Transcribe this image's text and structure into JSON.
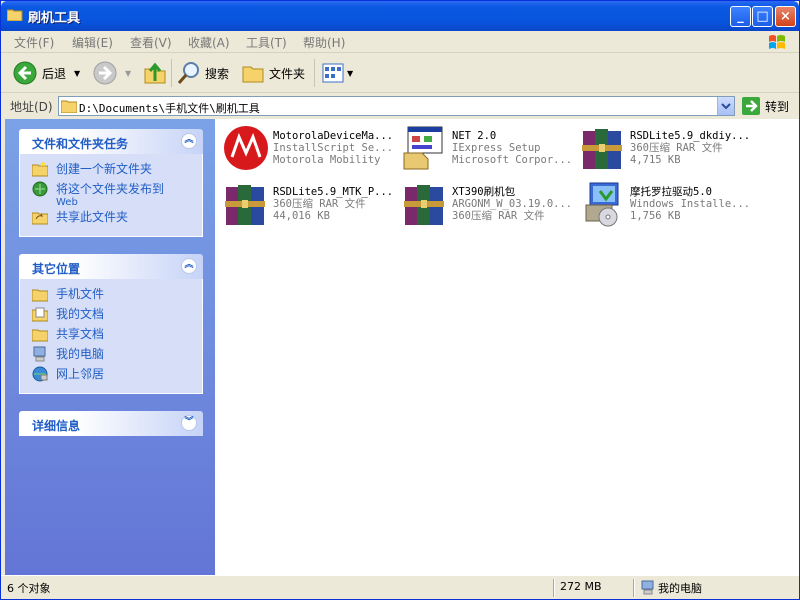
{
  "window": {
    "title": "刷机工具",
    "minimize": "_",
    "maximize": "□",
    "close": "×"
  },
  "menu": [
    "文件(F)",
    "编辑(E)",
    "查看(V)",
    "收藏(A)",
    "工具(T)",
    "帮助(H)"
  ],
  "toolbar": {
    "back": "后退",
    "search": "搜索",
    "folders": "文件夹"
  },
  "address": {
    "label": "地址(D)",
    "path": "D:\\Documents\\手机文件\\刷机工具",
    "go": "转到"
  },
  "tasks_panel": {
    "title": "文件和文件夹任务",
    "items": [
      {
        "label": "创建一个新文件夹",
        "icon": "new-folder-icon"
      },
      {
        "label": "将这个文件夹发布到",
        "sub": "Web",
        "icon": "publish-web-icon"
      },
      {
        "label": "共享此文件夹",
        "icon": "share-folder-icon"
      }
    ]
  },
  "places_panel": {
    "title": "其它位置",
    "items": [
      {
        "label": "手机文件",
        "icon": "folder-icon"
      },
      {
        "label": "我的文档",
        "icon": "my-documents-icon"
      },
      {
        "label": "共享文档",
        "icon": "shared-docs-icon"
      },
      {
        "label": "我的电脑",
        "icon": "computer-icon"
      },
      {
        "label": "网上邻居",
        "icon": "network-icon"
      }
    ]
  },
  "details_panel": {
    "title": "详细信息"
  },
  "files": [
    {
      "name": "MotorolaDeviceMa...",
      "type": "InstallScript Se...",
      "info": "Motorola Mobility",
      "icon": "motorola-icon"
    },
    {
      "name": "NET 2.0",
      "type": "IExpress Setup",
      "info": "Microsoft Corpor...",
      "icon": "setup-icon"
    },
    {
      "name": "RSDLite5.9_dkdiy...",
      "type": "360压缩 RAR 文件",
      "info": "4,715 KB",
      "icon": "rar-icon"
    },
    {
      "name": "RSDLite5.9_MTK_P...",
      "type": "360压缩 RAR 文件",
      "info": "44,016 KB",
      "icon": "rar-icon"
    },
    {
      "name": "XT390刷机包",
      "type": "ARGONM_W_03.19.0...",
      "info": "360压缩 RAR 文件",
      "icon": "rar-icon"
    },
    {
      "name": "摩托罗拉驱动5.0",
      "type": "Windows Installe...",
      "info": "1,756 KB",
      "icon": "msi-installer-icon"
    }
  ],
  "status": {
    "count": "6 个对象",
    "size": "272 MB",
    "location": "我的电脑"
  }
}
